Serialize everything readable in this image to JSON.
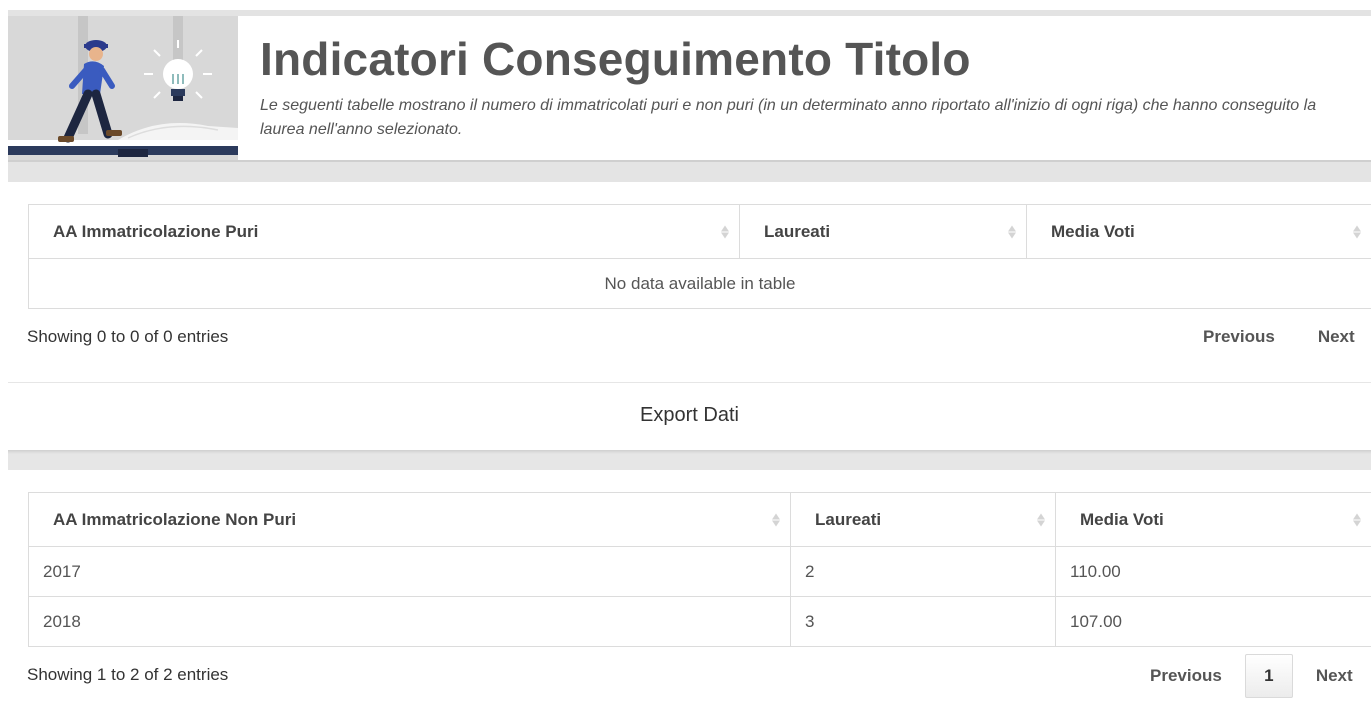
{
  "header": {
    "title": "Indicatori Conseguimento Titolo",
    "subtitle": "Le seguenti tabelle mostrano il numero di immatricolati puri e non puri (in un determinato anno riportato all'inizio di ogni riga) che hanno conseguito la laurea nell'anno selezionato."
  },
  "table_puri": {
    "columns": [
      "AA Immatricolazione Puri",
      "Laureati",
      "Media Voti"
    ],
    "empty_message": "No data available in table",
    "info": "Showing 0 to 0 of 0 entries",
    "pagination": {
      "previous": "Previous",
      "next": "Next"
    }
  },
  "export": {
    "label": "Export Dati"
  },
  "table_non_puri": {
    "columns": [
      "AA Immatricolazione Non Puri",
      "Laureati",
      "Media Voti"
    ],
    "rows": [
      [
        "2017",
        "2",
        "110.00"
      ],
      [
        "2018",
        "3",
        "107.00"
      ]
    ],
    "info": "Showing 1 to 2 of 2 entries",
    "pagination": {
      "previous": "Previous",
      "page": "1",
      "next": "Next"
    }
  }
}
